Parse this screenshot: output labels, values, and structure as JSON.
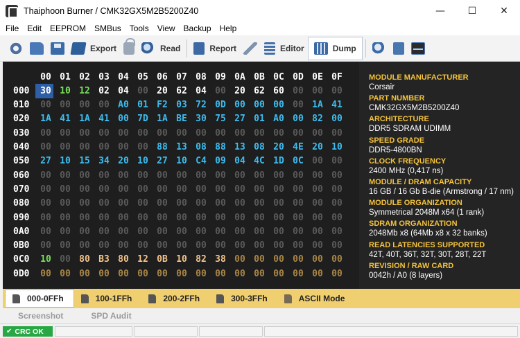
{
  "window": {
    "title": "Thaiphoon Burner / CMK32GX5M2B5200Z40",
    "minimize": "—",
    "maximize": "☐",
    "close": "✕"
  },
  "menu": [
    "File",
    "Edit",
    "EEPROM",
    "SMBus",
    "Tools",
    "View",
    "Backup",
    "Help"
  ],
  "toolbar": {
    "export": "Export",
    "read": "Read",
    "report": "Report",
    "editor": "Editor",
    "dump": "Dump"
  },
  "colors": {
    "zero": "#5a5a5a",
    "white": "#ffffff",
    "green": "#78e05a",
    "cyan": "#3dbdf0",
    "orange": "#f2c48a",
    "dim_orange": "#a88545",
    "label": "#f5c33b"
  },
  "hex": {
    "columns": [
      "00",
      "01",
      "02",
      "03",
      "04",
      "05",
      "06",
      "07",
      "08",
      "09",
      "0A",
      "0B",
      "0C",
      "0D",
      "0E",
      "0F"
    ],
    "rows": [
      {
        "addr": "000",
        "bytes": [
          "30",
          "10",
          "12",
          "02",
          "04",
          "00",
          "20",
          "62",
          "04",
          "00",
          "20",
          "62",
          "60",
          "00",
          "00",
          "00"
        ],
        "colors": [
          "white",
          "green",
          "green",
          "white",
          "white",
          "zero",
          "white",
          "white",
          "white",
          "zero",
          "white",
          "white",
          "white",
          "zero",
          "zero",
          "zero"
        ]
      },
      {
        "addr": "010",
        "bytes": [
          "00",
          "00",
          "00",
          "00",
          "A0",
          "01",
          "F2",
          "03",
          "72",
          "0D",
          "00",
          "00",
          "00",
          "00",
          "1A",
          "41"
        ],
        "colors": [
          "zero",
          "zero",
          "zero",
          "zero",
          "cyan",
          "cyan",
          "cyan",
          "cyan",
          "cyan",
          "cyan",
          "cyan",
          "cyan",
          "cyan",
          "zero",
          "cyan",
          "cyan"
        ]
      },
      {
        "addr": "020",
        "bytes": [
          "1A",
          "41",
          "1A",
          "41",
          "00",
          "7D",
          "1A",
          "BE",
          "30",
          "75",
          "27",
          "01",
          "A0",
          "00",
          "82",
          "00"
        ],
        "colors": [
          "cyan",
          "cyan",
          "cyan",
          "cyan",
          "cyan",
          "cyan",
          "cyan",
          "cyan",
          "cyan",
          "cyan",
          "cyan",
          "cyan",
          "cyan",
          "cyan",
          "cyan",
          "cyan"
        ]
      },
      {
        "addr": "030",
        "bytes": [
          "00",
          "00",
          "00",
          "00",
          "00",
          "00",
          "00",
          "00",
          "00",
          "00",
          "00",
          "00",
          "00",
          "00",
          "00",
          "00"
        ],
        "colors": [
          "zero",
          "zero",
          "zero",
          "zero",
          "zero",
          "zero",
          "zero",
          "zero",
          "zero",
          "zero",
          "zero",
          "zero",
          "zero",
          "zero",
          "zero",
          "zero"
        ]
      },
      {
        "addr": "040",
        "bytes": [
          "00",
          "00",
          "00",
          "00",
          "00",
          "00",
          "88",
          "13",
          "08",
          "88",
          "13",
          "08",
          "20",
          "4E",
          "20",
          "10"
        ],
        "colors": [
          "zero",
          "zero",
          "zero",
          "zero",
          "zero",
          "zero",
          "cyan",
          "cyan",
          "cyan",
          "cyan",
          "cyan",
          "cyan",
          "cyan",
          "cyan",
          "cyan",
          "cyan"
        ]
      },
      {
        "addr": "050",
        "bytes": [
          "27",
          "10",
          "15",
          "34",
          "20",
          "10",
          "27",
          "10",
          "C4",
          "09",
          "04",
          "4C",
          "1D",
          "0C",
          "00",
          "00"
        ],
        "colors": [
          "cyan",
          "cyan",
          "cyan",
          "cyan",
          "cyan",
          "cyan",
          "cyan",
          "cyan",
          "cyan",
          "cyan",
          "cyan",
          "cyan",
          "cyan",
          "cyan",
          "zero",
          "zero"
        ]
      },
      {
        "addr": "060",
        "bytes": [
          "00",
          "00",
          "00",
          "00",
          "00",
          "00",
          "00",
          "00",
          "00",
          "00",
          "00",
          "00",
          "00",
          "00",
          "00",
          "00"
        ],
        "colors": [
          "zero",
          "zero",
          "zero",
          "zero",
          "zero",
          "zero",
          "zero",
          "zero",
          "zero",
          "zero",
          "zero",
          "zero",
          "zero",
          "zero",
          "zero",
          "zero"
        ]
      },
      {
        "addr": "070",
        "bytes": [
          "00",
          "00",
          "00",
          "00",
          "00",
          "00",
          "00",
          "00",
          "00",
          "00",
          "00",
          "00",
          "00",
          "00",
          "00",
          "00"
        ],
        "colors": [
          "zero",
          "zero",
          "zero",
          "zero",
          "zero",
          "zero",
          "zero",
          "zero",
          "zero",
          "zero",
          "zero",
          "zero",
          "zero",
          "zero",
          "zero",
          "zero"
        ]
      },
      {
        "addr": "080",
        "bytes": [
          "00",
          "00",
          "00",
          "00",
          "00",
          "00",
          "00",
          "00",
          "00",
          "00",
          "00",
          "00",
          "00",
          "00",
          "00",
          "00"
        ],
        "colors": [
          "zero",
          "zero",
          "zero",
          "zero",
          "zero",
          "zero",
          "zero",
          "zero",
          "zero",
          "zero",
          "zero",
          "zero",
          "zero",
          "zero",
          "zero",
          "zero"
        ]
      },
      {
        "addr": "090",
        "bytes": [
          "00",
          "00",
          "00",
          "00",
          "00",
          "00",
          "00",
          "00",
          "00",
          "00",
          "00",
          "00",
          "00",
          "00",
          "00",
          "00"
        ],
        "colors": [
          "zero",
          "zero",
          "zero",
          "zero",
          "zero",
          "zero",
          "zero",
          "zero",
          "zero",
          "zero",
          "zero",
          "zero",
          "zero",
          "zero",
          "zero",
          "zero"
        ]
      },
      {
        "addr": "0A0",
        "bytes": [
          "00",
          "00",
          "00",
          "00",
          "00",
          "00",
          "00",
          "00",
          "00",
          "00",
          "00",
          "00",
          "00",
          "00",
          "00",
          "00"
        ],
        "colors": [
          "zero",
          "zero",
          "zero",
          "zero",
          "zero",
          "zero",
          "zero",
          "zero",
          "zero",
          "zero",
          "zero",
          "zero",
          "zero",
          "zero",
          "zero",
          "zero"
        ]
      },
      {
        "addr": "0B0",
        "bytes": [
          "00",
          "00",
          "00",
          "00",
          "00",
          "00",
          "00",
          "00",
          "00",
          "00",
          "00",
          "00",
          "00",
          "00",
          "00",
          "00"
        ],
        "colors": [
          "zero",
          "zero",
          "zero",
          "zero",
          "zero",
          "zero",
          "zero",
          "zero",
          "zero",
          "zero",
          "zero",
          "zero",
          "zero",
          "zero",
          "zero",
          "zero"
        ]
      },
      {
        "addr": "0C0",
        "bytes": [
          "10",
          "00",
          "80",
          "B3",
          "80",
          "12",
          "0B",
          "10",
          "82",
          "38",
          "00",
          "00",
          "00",
          "00",
          "00",
          "00"
        ],
        "colors": [
          "green",
          "zero",
          "orange",
          "orange",
          "orange",
          "orange",
          "orange",
          "orange",
          "orange",
          "orange",
          "dim_orange",
          "dim_orange",
          "dim_orange",
          "dim_orange",
          "dim_orange",
          "dim_orange"
        ]
      },
      {
        "addr": "0D0",
        "bytes": [
          "00",
          "00",
          "00",
          "00",
          "00",
          "00",
          "00",
          "00",
          "00",
          "00",
          "00",
          "00",
          "00",
          "00",
          "00",
          "00"
        ],
        "colors": [
          "dim_orange",
          "dim_orange",
          "dim_orange",
          "dim_orange",
          "dim_orange",
          "dim_orange",
          "dim_orange",
          "dim_orange",
          "dim_orange",
          "dim_orange",
          "dim_orange",
          "dim_orange",
          "dim_orange",
          "dim_orange",
          "dim_orange",
          "dim_orange"
        ]
      }
    ]
  },
  "info": [
    {
      "label": "MODULE MANUFACTURER",
      "value": "Corsair"
    },
    {
      "label": "PART NUMBER",
      "value": "CMK32GX5M2B5200Z40"
    },
    {
      "label": "ARCHITECTURE",
      "value": "DDR5 SDRAM UDIMM"
    },
    {
      "label": "SPEED GRADE",
      "value": "DDR5-4800BN"
    },
    {
      "label": "CLOCK FREQUENCY",
      "value": "2400 MHz (0,417 ns)"
    },
    {
      "label": "MODULE / DRAM CAPACITY",
      "value": "16 GB / 16 Gb B-die (Armstrong / 17 nm)"
    },
    {
      "label": "MODULE ORGANIZATION",
      "value": "Symmetrical 2048M x64 (1 rank)"
    },
    {
      "label": "SDRAM ORGANIZATION",
      "value": "2048Mb x8 (64Mb x8 x 32 banks)"
    },
    {
      "label": "READ LATENCIES SUPPORTED",
      "value": "42T, 40T, 36T, 32T, 30T, 28T, 22T"
    },
    {
      "label": "REVISION / RAW CARD",
      "value": "0042h / A0 (8 layers)"
    }
  ],
  "tabs": [
    "000-0FFh",
    "100-1FFh",
    "200-2FFh",
    "300-3FFh",
    "ASCII Mode"
  ],
  "actions": {
    "screenshot": "Screenshot",
    "spd_audit": "SPD Audit"
  },
  "status": {
    "crc": "CRC OK"
  }
}
